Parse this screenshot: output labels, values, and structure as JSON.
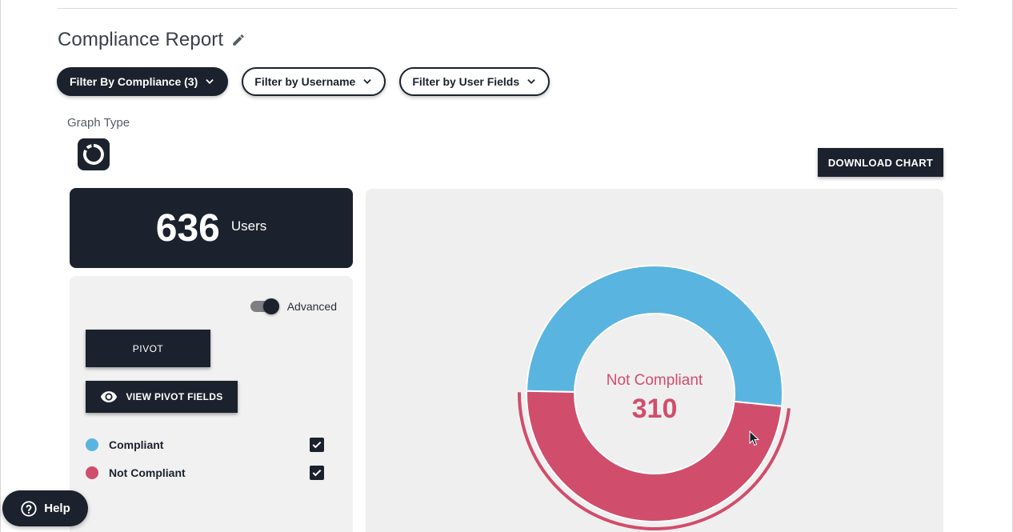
{
  "page": {
    "title": "Compliance Report"
  },
  "filters": [
    {
      "label": "Filter By Compliance (3)",
      "active": true
    },
    {
      "label": "Filter by Username",
      "active": false
    },
    {
      "label": "Filter by User Fields",
      "active": false
    }
  ],
  "graph_type": {
    "label": "Graph Type",
    "selected_icon": "donut-chart-icon"
  },
  "download_label": "DOWNLOAD CHART",
  "summary": {
    "count": "636",
    "unit": "Users"
  },
  "panel": {
    "advanced_label": "Advanced",
    "advanced_on": true,
    "pivot_label": "PIVOT",
    "view_pivot_label": "VIEW PIVOT FIELDS"
  },
  "legend": [
    {
      "label": "Compliant",
      "color": "#5ab4e0",
      "checked": true
    },
    {
      "label": "Not Compliant",
      "color": "#d14d6c",
      "checked": true
    }
  ],
  "chart_data": {
    "type": "pie",
    "categories": [
      "Compliant",
      "Not Compliant"
    ],
    "values": [
      326,
      310
    ],
    "colors": [
      "#5ab4e0",
      "#d14d6c"
    ],
    "highlighted": "Not Compliant",
    "center_label": "Not Compliant",
    "center_value": "310"
  },
  "help_label": "Help"
}
